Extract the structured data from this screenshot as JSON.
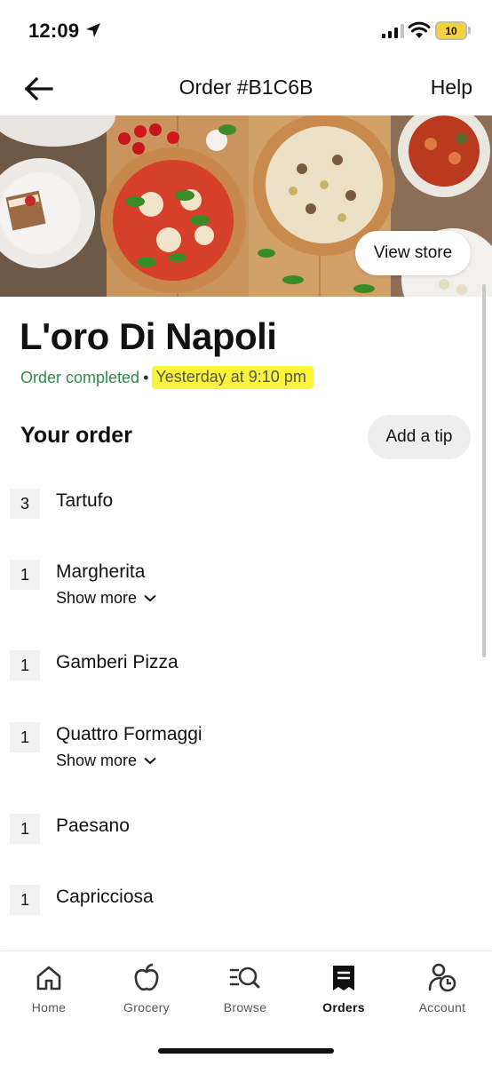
{
  "status_bar": {
    "time": "12:09",
    "battery": "10"
  },
  "header": {
    "title": "Order #B1C6B",
    "help": "Help",
    "back_icon": "arrow-left-icon"
  },
  "hero": {
    "view_store": "View store"
  },
  "store": {
    "name": "L'oro Di Napoli",
    "status": "Order completed",
    "separator": "•",
    "time": "Yesterday at 9:10 pm"
  },
  "order": {
    "title": "Your order",
    "add_tip": "Add a tip",
    "items": [
      {
        "qty": "3",
        "name": "Tartufo"
      },
      {
        "qty": "1",
        "name": "Margherita",
        "more": "Show more"
      },
      {
        "qty": "1",
        "name": "Gamberi Pizza"
      },
      {
        "qty": "1",
        "name": "Quattro Formaggi",
        "more": "Show more"
      },
      {
        "qty": "1",
        "name": "Paesano"
      },
      {
        "qty": "1",
        "name": "Capricciosa"
      }
    ]
  },
  "bottom_nav": {
    "tabs": [
      {
        "label": "Home",
        "icon": "home-icon"
      },
      {
        "label": "Grocery",
        "icon": "apple-icon"
      },
      {
        "label": "Browse",
        "icon": "browse-search-icon"
      },
      {
        "label": "Orders",
        "icon": "receipt-icon",
        "active": true
      },
      {
        "label": "Account",
        "icon": "account-icon"
      }
    ]
  },
  "colors": {
    "status_green": "#2f8a4e",
    "highlight_yellow": "#fbf53a"
  }
}
